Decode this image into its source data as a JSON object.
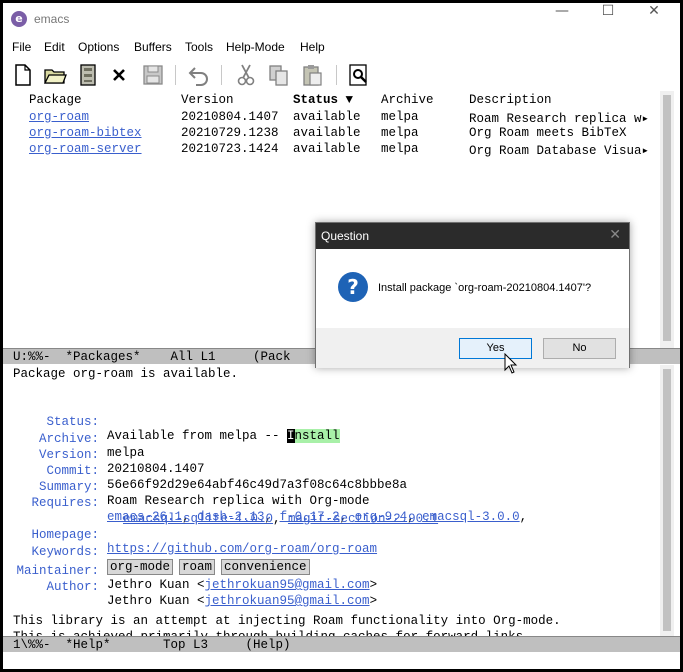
{
  "window": {
    "title": "emacs",
    "icon_letter": "e",
    "controls": {
      "minimize": "—",
      "maximize": "☐",
      "close": "✕"
    }
  },
  "menu": [
    "File",
    "Edit",
    "Options",
    "Buffers",
    "Tools",
    "Help-Mode",
    "Help"
  ],
  "toolbar": [
    "new-file-icon",
    "open-folder-icon",
    "save-cabinet-icon",
    "close-x-icon",
    "save-disk-icon",
    "undo-icon",
    "cut-icon",
    "copy-icon",
    "paste-icon",
    "search-icon"
  ],
  "packages": {
    "headers": {
      "package": "Package",
      "version": "Version",
      "status": "Status ▼",
      "archive": "Archive",
      "description": "Description"
    },
    "rows": [
      {
        "name": "org-roam",
        "version": "20210804.1407",
        "status": "available",
        "archive": "melpa",
        "description": "Roam Research replica w▸"
      },
      {
        "name": "org-roam-bibtex",
        "version": "20210729.1238",
        "status": "available",
        "archive": "melpa",
        "description": "Org Roam meets BibTeX"
      },
      {
        "name": "org-roam-server",
        "version": "20210723.1424",
        "status": "available",
        "archive": "melpa",
        "description": "Org Roam Database Visua▸"
      }
    ]
  },
  "modeline1": {
    "left": "U:%%-  *Packages*    All L1     (Pack"
  },
  "help": {
    "heading": "Package org-roam is available.",
    "status_label": "Status:",
    "status_value": "Available from melpa -- ",
    "install_cursor": "I",
    "install_rest": "nstall",
    "archive_label": "Archive:",
    "archive_value": "melpa",
    "version_label": "Version:",
    "version_value": "20210804.1407",
    "commit_label": "Commit:",
    "commit_value": "56e66f92d29e64abf46c49d7a3f08c64c8bbbe8a",
    "summary_label": "Summary:",
    "summary_value": "Roam Research replica with Org-mode",
    "requires_label": "Requires:",
    "requires_line1": [
      "emacs-26.1",
      "dash-2.13",
      "f-0.17.2",
      "org-9.4",
      "emacsql-3.0.0"
    ],
    "requires_line2": [
      "emacsql-sqlite-1.0.0",
      "magit-section-2.90.1"
    ],
    "homepage_label": "Homepage:",
    "homepage_value": "https://github.com/org-roam/org-roam",
    "keywords_label": "Keywords:",
    "keywords": [
      "org-mode",
      "roam",
      "convenience"
    ],
    "maintainer_label": "Maintainer:",
    "maintainer_name": "Jethro Kuan <",
    "maintainer_email": "jethrokuan95@gmail.com",
    "author_label": "Author:",
    "author_name": "Jethro Kuan <",
    "author_email": "jethrokuan95@gmail.com",
    "desc_line1": "This library is an attempt at injecting Roam functionality into Org-mode.",
    "desc_line2": "This is achieved primarily through building caches for forward links,"
  },
  "modeline2": {
    "left": "1\\%%-  *Help*       Top L3     (Help)"
  },
  "dialog": {
    "title": "Question",
    "message": "Install package `org-roam-20210804.1407'?",
    "yes": "Yes",
    "no": "No"
  }
}
